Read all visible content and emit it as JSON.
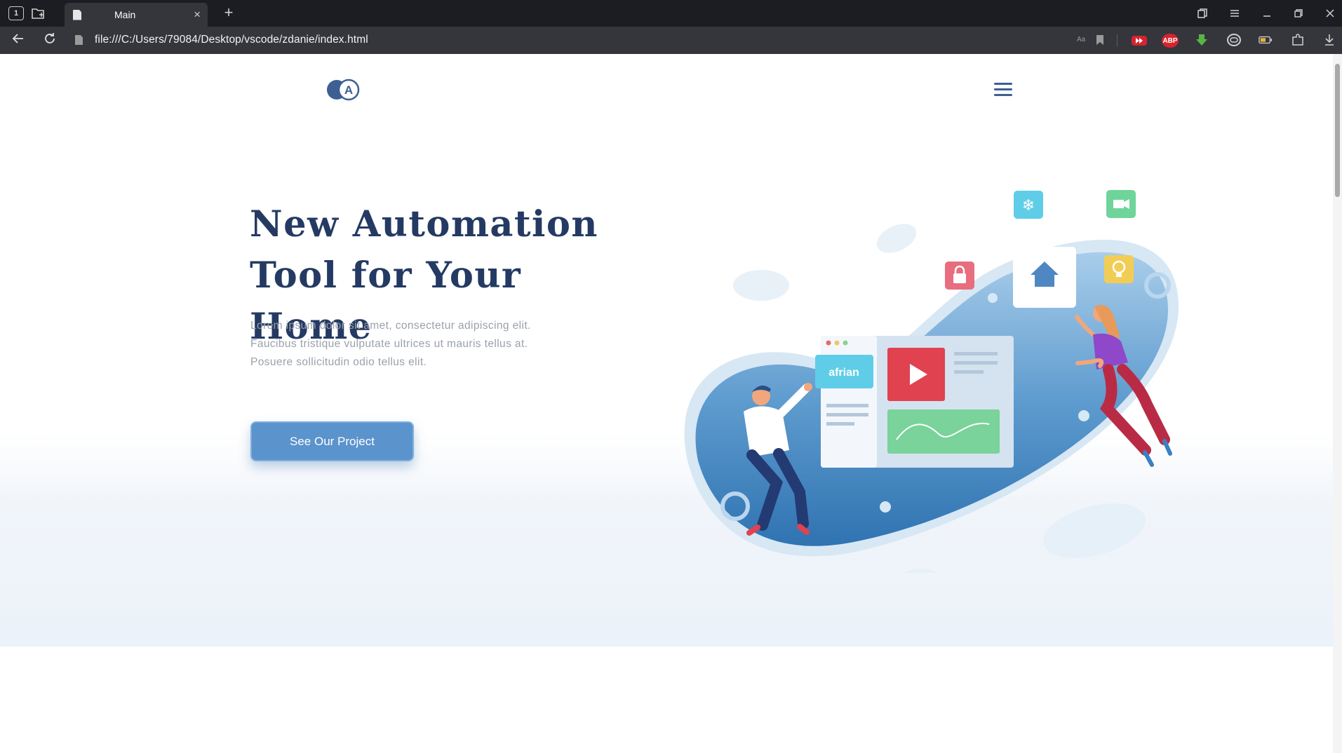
{
  "browser": {
    "tab_count": "1",
    "tab_title": "Main",
    "tab_close": "×",
    "new_tab": "+",
    "url": "file:///C:/Users/79084/Desktop/vscode/zdanie/index.html",
    "extensions": [
      {
        "name": "video-ext-icon",
        "label": "",
        "color": "#d6232f"
      },
      {
        "name": "adblock-icon",
        "label": "ABP",
        "color": "#d6232f"
      },
      {
        "name": "download-helper-icon",
        "label": "",
        "color": "#58b544"
      },
      {
        "name": "vpn-icon",
        "label": "",
        "color": "#cfcfcf"
      },
      {
        "name": "battery-icon",
        "label": "",
        "color": "#e6b13c"
      }
    ]
  },
  "page": {
    "headline_line1": "New Automation",
    "headline_line2": "Tool for Your Home",
    "description": "Lorem ipsum dolor sit amet, consectetur adipiscing elit. Faucibus tristique vulputate ultrices ut mauris tellus at. Posuere sollicitudin odio tellus elit.",
    "cta_label": "See Our Project",
    "logo_letter": "A",
    "illustration_label": "afrian"
  },
  "colors": {
    "heading": "#243a63",
    "accent": "#5b93cc",
    "body_text": "#9aa1ab"
  }
}
